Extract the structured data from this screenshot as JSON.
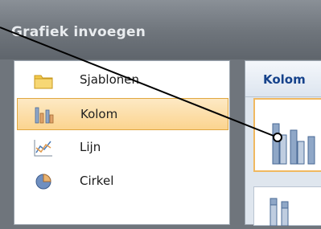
{
  "dialog": {
    "title": "Grafiek invoegen"
  },
  "categories": [
    {
      "label": "Sjablonen",
      "icon": "folder-icon"
    },
    {
      "label": "Kolom",
      "icon": "column-chart-icon",
      "selected": true
    },
    {
      "label": "Lijn",
      "icon": "line-chart-icon"
    },
    {
      "label": "Cirkel",
      "icon": "pie-chart-icon"
    }
  ],
  "gallery": {
    "section_title": "Kolom"
  },
  "colors": {
    "selection": "#fbd48f",
    "selection_border": "#e0a73f",
    "header_text": "#15428b"
  }
}
